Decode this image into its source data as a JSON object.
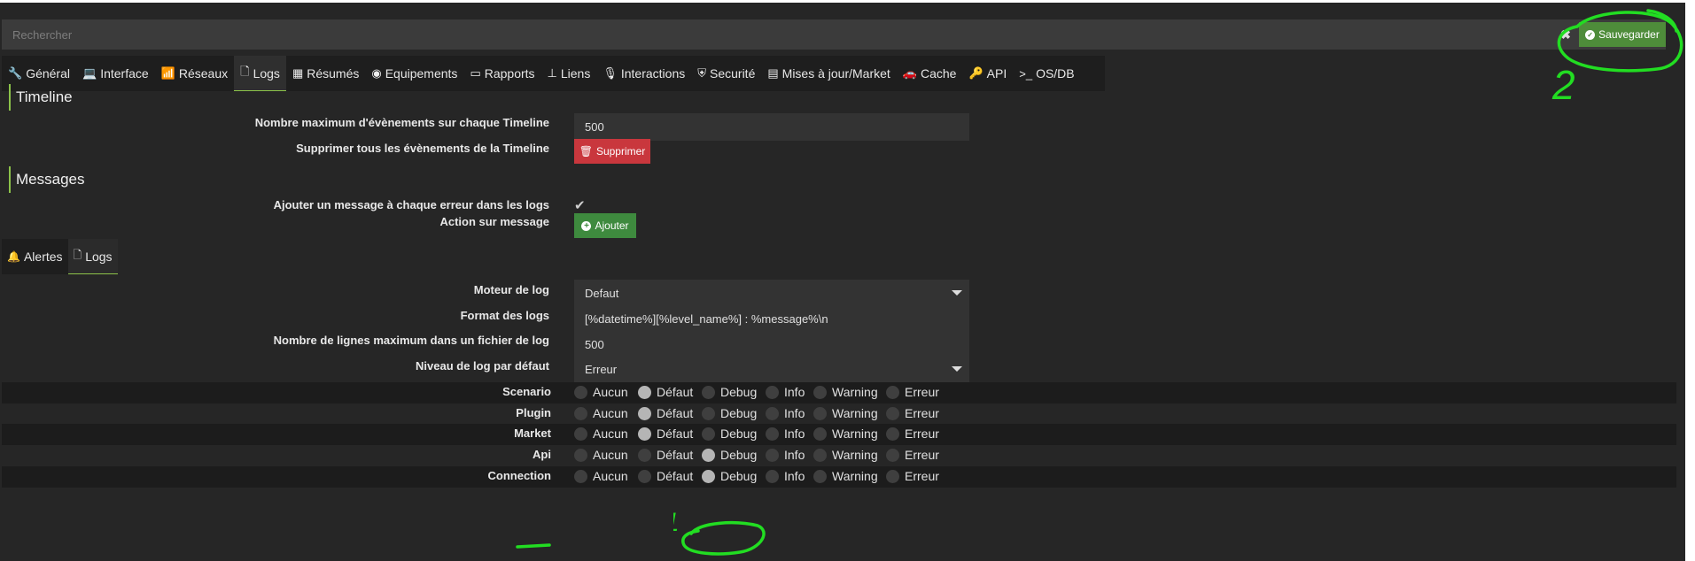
{
  "search": {
    "placeholder": "Rechercher"
  },
  "toolbar": {
    "close_label": "✖",
    "save_label": "Sauvegarder"
  },
  "tabs": [
    {
      "label": "Général",
      "icon": "wrench-icon",
      "glyph": "🔧"
    },
    {
      "label": "Interface",
      "icon": "laptop-icon",
      "glyph": "💻"
    },
    {
      "label": "Réseaux",
      "icon": "rss-icon",
      "glyph": "📶"
    },
    {
      "label": "Logs",
      "icon": "file-icon",
      "glyph": "🗋"
    },
    {
      "label": "Résumés",
      "icon": "table-icon",
      "glyph": "▦"
    },
    {
      "label": "Equipements",
      "icon": "circle-icon",
      "glyph": "◉"
    },
    {
      "label": "Rapports",
      "icon": "hdd-icon",
      "glyph": "▭"
    },
    {
      "label": "Liens",
      "icon": "sitemap-icon",
      "glyph": "⊥"
    },
    {
      "label": "Interactions",
      "icon": "microphone-icon",
      "glyph": "🎙"
    },
    {
      "label": "Securité",
      "icon": "shield-icon",
      "glyph": "⛨"
    },
    {
      "label": "Mises à jour/Market",
      "icon": "server-icon",
      "glyph": "▤"
    },
    {
      "label": "Cache",
      "icon": "car-icon",
      "glyph": "🚗"
    },
    {
      "label": "API",
      "icon": "key-icon",
      "glyph": "🔑"
    },
    {
      "label": "OS/DB",
      "icon": "terminal-icon",
      "glyph": ">_"
    }
  ],
  "active_tab": "Logs",
  "timeline": {
    "title": "Timeline",
    "max_events_label": "Nombre maximum d'évènements sur chaque Timeline",
    "max_events_value": "500",
    "delete_label": "Supprimer tous les évènements de la Timeline",
    "delete_button": "Supprimer"
  },
  "messages": {
    "title": "Messages",
    "add_msg_label": "Ajouter un message à chaque erreur dans les logs",
    "add_msg_checked": true,
    "action_label": "Action sur message",
    "add_button": "Ajouter"
  },
  "subtabs": [
    {
      "label": "Alertes",
      "icon": "bell-icon",
      "glyph": "🔔"
    },
    {
      "label": "Logs",
      "icon": "file-icon",
      "glyph": "🗋"
    }
  ],
  "logs": {
    "engine_label": "Moteur de log",
    "engine_value": "Defaut",
    "format_label": "Format des logs",
    "format_value": "[%datetime%][%level_name%] : %message%\\n",
    "maxlines_label": "Nombre de lignes maximum dans un fichier de log",
    "maxlines_value": "500",
    "level_label": "Niveau de log par défaut",
    "level_value": "Erreur"
  },
  "levels": [
    "Aucun",
    "Défaut",
    "Debug",
    "Info",
    "Warning",
    "Erreur"
  ],
  "log_rows": [
    {
      "name": "Scenario",
      "selected": "Défaut"
    },
    {
      "name": "Plugin",
      "selected": "Défaut"
    },
    {
      "name": "Market",
      "selected": "Défaut"
    },
    {
      "name": "Api",
      "selected": "Debug"
    },
    {
      "name": "Connection",
      "selected": "Debug"
    }
  ],
  "annotations": {
    "one": "1",
    "two": "2",
    "color": "#22dd22"
  },
  "colors": {
    "accent": "#8cc34a",
    "save": "#4e8c3a",
    "danger": "#c9373d",
    "add": "#3e8a3e",
    "bg": "#262626"
  }
}
